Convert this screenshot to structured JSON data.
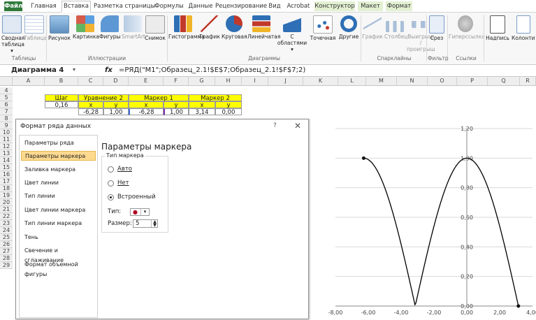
{
  "tabs": [
    "Файл",
    "Главная",
    "Вставка",
    "Разметка страницы",
    "Формулы",
    "Данные",
    "Рецензирование",
    "Вид",
    "Acrobat",
    "Конструктор",
    "Макет",
    "Формат"
  ],
  "ribbon": {
    "buttons": [
      "Сводная таблица ▾",
      "Таблица",
      "Рисунок",
      "Картинка",
      "Фигуры",
      "SmartArt",
      "Снимок",
      "Гистограмма",
      "График",
      "Круговая",
      "Линейчатая",
      "С областями ▾",
      "Точечная",
      "Другие",
      "График",
      "Столбец",
      "Выигрыш / проигрыш",
      "Срез",
      "Гиперссылка",
      "Надпись",
      "Колонтиту"
    ],
    "groups": [
      "Таблицы",
      "Иллюстрации",
      "Диаграммы",
      "Спарклайны",
      "Фильтр",
      "Ссылки"
    ]
  },
  "formula_bar": {
    "name_box": "Диаграмма 4",
    "fx": "fx",
    "formula": "=РЯД(\"М1\";Образец_2.1!$E$7;Образец_2.1!$F$7;2)"
  },
  "sheet": {
    "columns": [
      "A",
      "B",
      "C",
      "D",
      "E",
      "F",
      "G",
      "H",
      "I",
      "J",
      "K",
      "L",
      "M",
      "N",
      "O",
      "P",
      "Q",
      "R"
    ],
    "rows": [
      "4",
      "5",
      "6",
      "7",
      "8",
      "9",
      "10",
      "11",
      "12",
      "13",
      "14",
      "15",
      "16",
      "17",
      "18",
      "19",
      "20",
      "21",
      "22",
      "23",
      "24",
      "25",
      "26",
      "27",
      "28",
      "29"
    ],
    "r5": [
      "Шаг",
      "Уравнение 2",
      "Маркер 1",
      "Маркер 2"
    ],
    "r6": [
      "0,16",
      "x",
      "y",
      "x",
      "y",
      "x",
      "y"
    ],
    "r7": [
      "-6,28",
      "1,00",
      "-6,28",
      "1,00",
      "3,14",
      "0,00"
    ]
  },
  "dialog": {
    "title": "Формат ряда данных",
    "help": "?",
    "close": "✕",
    "nav": [
      "Параметры ряда",
      "Параметры маркера",
      "Заливка маркера",
      "Цвет линии",
      "Тип линии",
      "Цвет линии маркера",
      "Тип линии маркера",
      "Тень",
      "Свечение и сглаживание",
      "Формат объемной фигуры"
    ],
    "panel_title": "Параметры маркера",
    "group_title": "Тип маркера",
    "radio_auto": "Авто",
    "radio_none": "Нет",
    "radio_builtin": "Встроенный",
    "type_label": "Тип:",
    "size_label": "Размер:",
    "size_value": "5"
  },
  "chart_data": {
    "type": "scatter",
    "y_ticks": [
      "1,20",
      "1,00",
      "0,80",
      "0,60",
      "0,40",
      "0,20",
      "0,00"
    ],
    "x_ticks": [
      "-8,00",
      "-6,00",
      "-4,00",
      "-2,00",
      "0,00",
      "2,00",
      "4,00"
    ],
    "xlim": [
      -8,
      4
    ],
    "ylim": [
      0,
      1.2
    ],
    "curve": "y = |cos(x/2)|",
    "curve_range": [
      -6.28,
      3.14
    ],
    "markers": [
      {
        "x": -6.28,
        "y": 1.0
      },
      {
        "x": 3.14,
        "y": 0.0
      }
    ]
  }
}
